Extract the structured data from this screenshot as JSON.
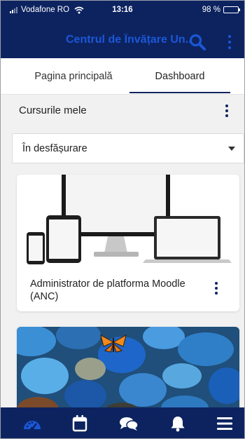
{
  "status_bar": {
    "carrier": "Vodafone RO",
    "time": "13:16",
    "battery": "98 %",
    "battery_level": 0.98
  },
  "header": {
    "title": "Centrul de Învățare Un...",
    "search_icon": "search-icon",
    "menu_icon": "more-vertical-icon"
  },
  "tabs": [
    {
      "label": "Pagina principală",
      "active": false
    },
    {
      "label": "Dashboard",
      "active": true
    }
  ],
  "courses": {
    "title": "Cursurile mele",
    "filter": {
      "selected": "În desfășurare"
    },
    "items": [
      {
        "name": "Administrator de platforma Moodle (ANC)",
        "image": "devices-illustration"
      },
      {
        "name": "",
        "image": "blue-stones-butterfly"
      }
    ]
  },
  "bottom_nav": [
    {
      "icon": "dashboard-icon",
      "active": true
    },
    {
      "icon": "calendar-icon",
      "active": false
    },
    {
      "icon": "messages-icon",
      "active": false
    },
    {
      "icon": "notifications-icon",
      "active": false
    },
    {
      "icon": "menu-icon",
      "active": false
    }
  ],
  "colors": {
    "primary": "#0d2360",
    "accent": "#1b57d6",
    "background": "#f1f1f1"
  }
}
